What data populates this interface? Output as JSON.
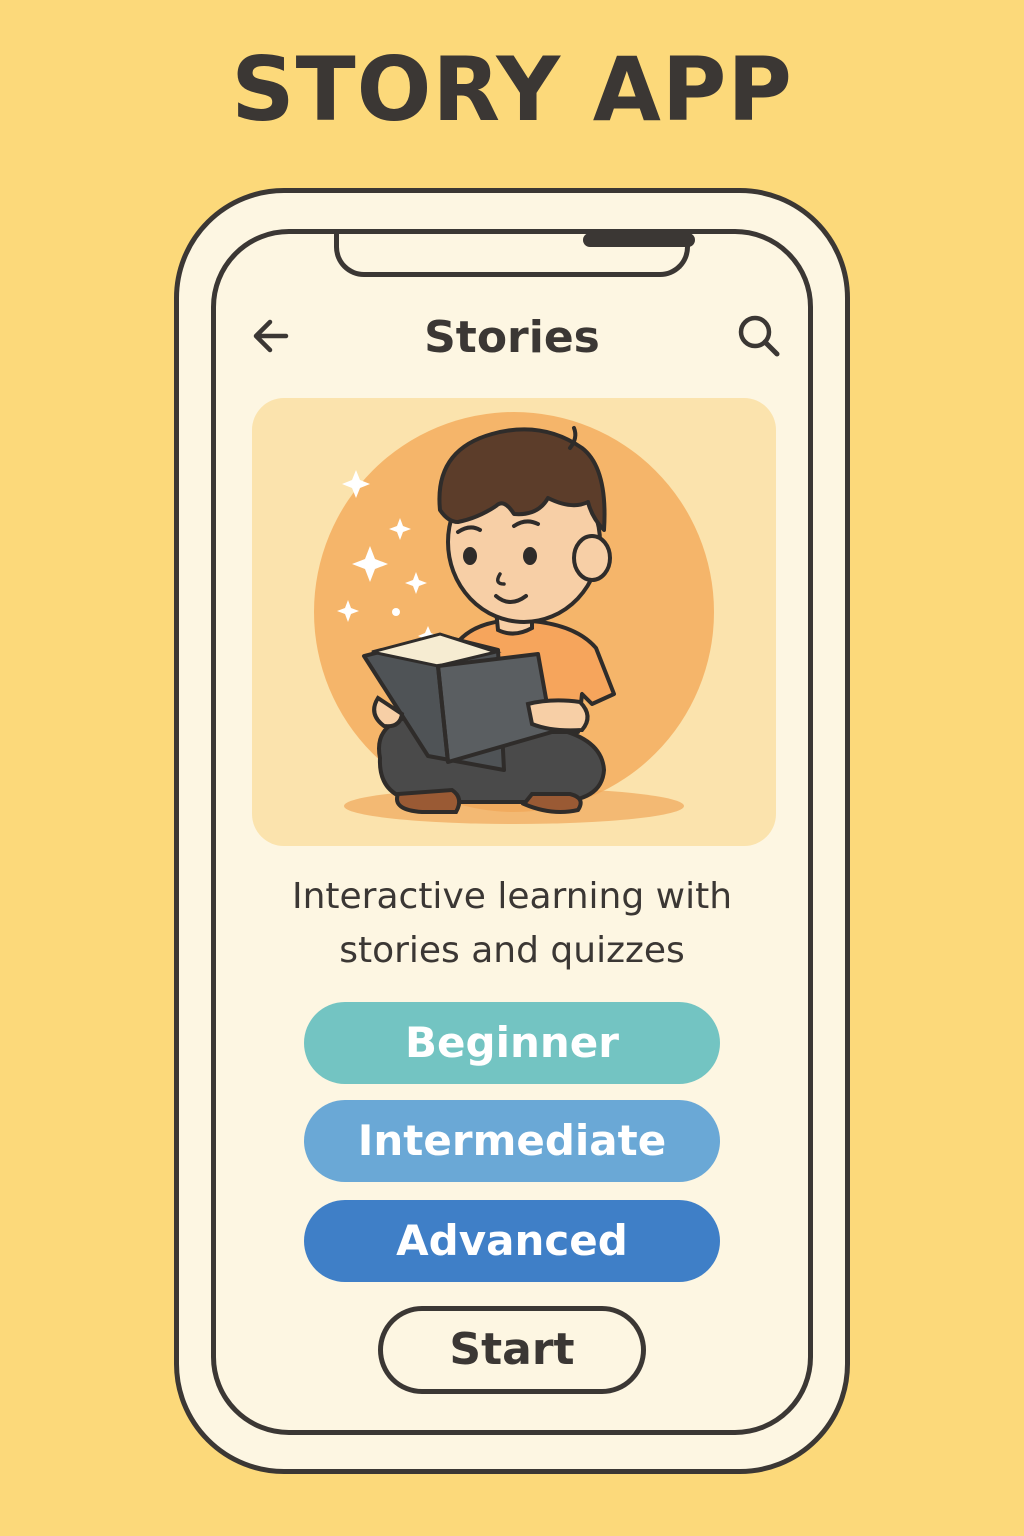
{
  "app": {
    "title": "STORY APP"
  },
  "header": {
    "title": "Stories",
    "back_icon": "back-arrow-icon",
    "search_icon": "search-icon"
  },
  "hero": {
    "illustration": "child-reading-book-illustration"
  },
  "tagline": "Interactive learning with stories and quizzes",
  "levels": [
    {
      "label": "Beginner",
      "color": "#73c4c2"
    },
    {
      "label": "Intermediate",
      "color": "#6aa8d6"
    },
    {
      "label": "Advanced",
      "color": "#3f7fc7"
    }
  ],
  "start_button": {
    "label": "Start"
  },
  "colors": {
    "background": "#fcd97a",
    "screen": "#fdf6e2",
    "outline": "#3b3734",
    "hero_bg": "#fbe3ad",
    "hero_circle": "#f5b56a"
  }
}
